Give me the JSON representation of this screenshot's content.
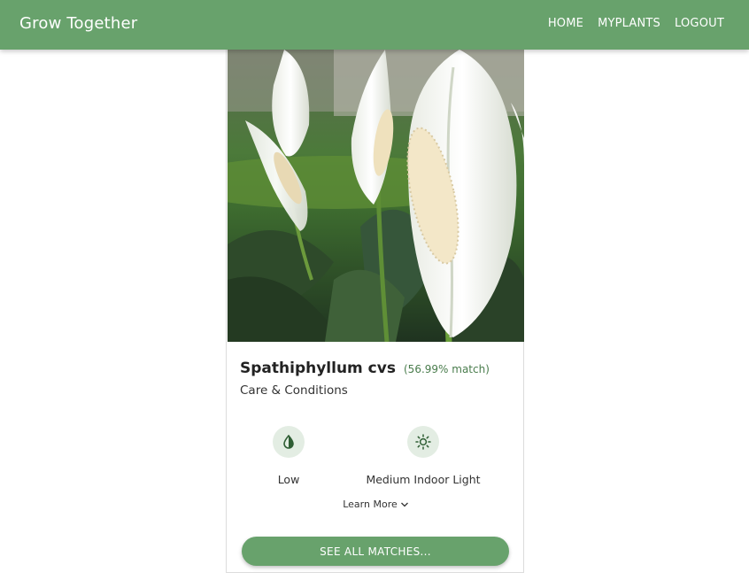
{
  "navbar": {
    "brand": "Grow Together",
    "links": [
      {
        "label": "HOME"
      },
      {
        "label": "MYPLANTS"
      },
      {
        "label": "LOGOUT"
      }
    ],
    "color": "#68a26c"
  },
  "plant": {
    "name": "Spathiphyllum cvs",
    "match": "(56.99% match)",
    "care_title": "Care & Conditions",
    "conditions": [
      {
        "icon": "water-drop-icon",
        "label": "Low"
      },
      {
        "icon": "sun-icon",
        "label": "Medium Indoor Light"
      }
    ]
  },
  "learn_more": "Learn More",
  "see_all_button": "SEE ALL MATCHES..."
}
